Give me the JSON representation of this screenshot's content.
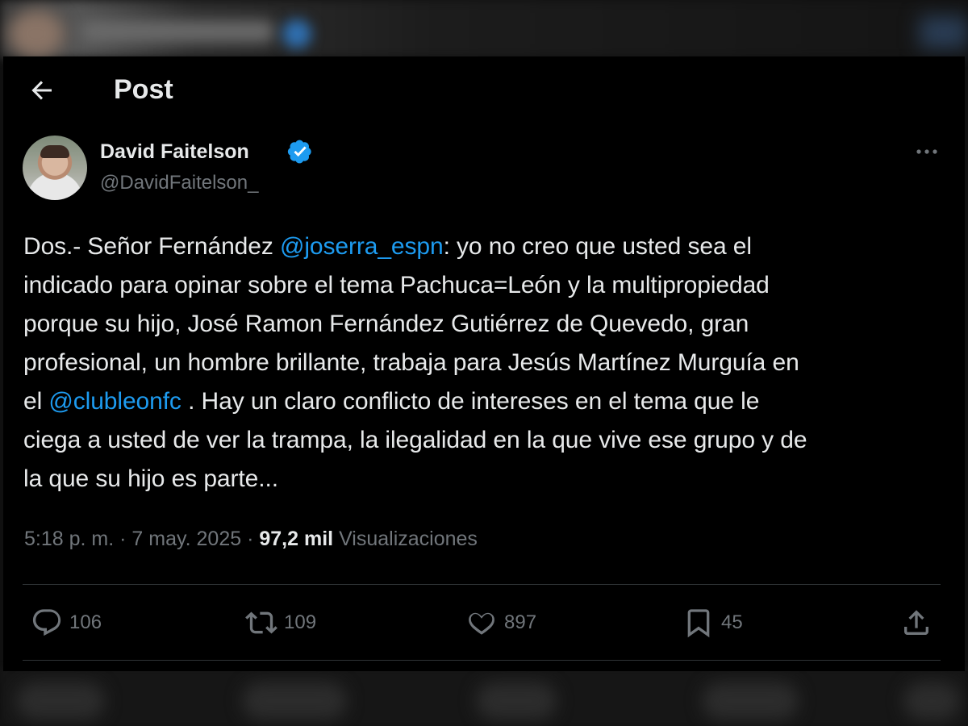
{
  "header": {
    "title": "Post"
  },
  "post": {
    "author": {
      "name": "David Faitelson",
      "handle": "@DavidFaitelson_",
      "verified": true
    },
    "text_lines": [
      [
        {
          "t": "Dos.- Señor Fernández ",
          "mention": false
        },
        {
          "t": "@joserra_espn",
          "mention": true
        },
        {
          "t": ": yo no creo que usted sea el",
          "mention": false
        }
      ],
      [
        {
          "t": "indicado para opinar sobre el tema Pachuca=León y la multipropiedad",
          "mention": false
        }
      ],
      [
        {
          "t": "porque su hijo, José Ramon Fernández Gutiérrez de Quevedo, gran",
          "mention": false
        }
      ],
      [
        {
          "t": "profesional, un hombre brillante, trabaja para Jesús Martínez Murguía en",
          "mention": false
        }
      ],
      [
        {
          "t": "el ",
          "mention": false
        },
        {
          "t": "@clubleonfc",
          "mention": true
        },
        {
          "t": " . Hay un claro conflicto de intereses en el tema que le",
          "mention": false
        }
      ],
      [
        {
          "t": "ciega a usted de ver la trampa, la ilegalidad en la que vive ese grupo y de",
          "mention": false
        }
      ],
      [
        {
          "t": "la que su hijo es parte...",
          "mention": false
        }
      ]
    ],
    "time": "5:18 p. m.",
    "separator": "·",
    "date": "7 may. 2025",
    "views_count": "97,2 mil",
    "views_label": "Visualizaciones"
  },
  "actions": {
    "replies": "106",
    "reposts": "109",
    "likes": "897",
    "bookmarks": "45"
  },
  "icons": [
    "back-arrow-icon",
    "verified-badge-icon",
    "more-icon",
    "reply-icon",
    "repost-icon",
    "like-icon",
    "bookmark-icon",
    "share-icon"
  ],
  "colors": {
    "background": "#000000",
    "text": "#e7e9ea",
    "secondary_text": "#71767b",
    "accent": "#1d9bf0",
    "divider": "#2f3336"
  }
}
